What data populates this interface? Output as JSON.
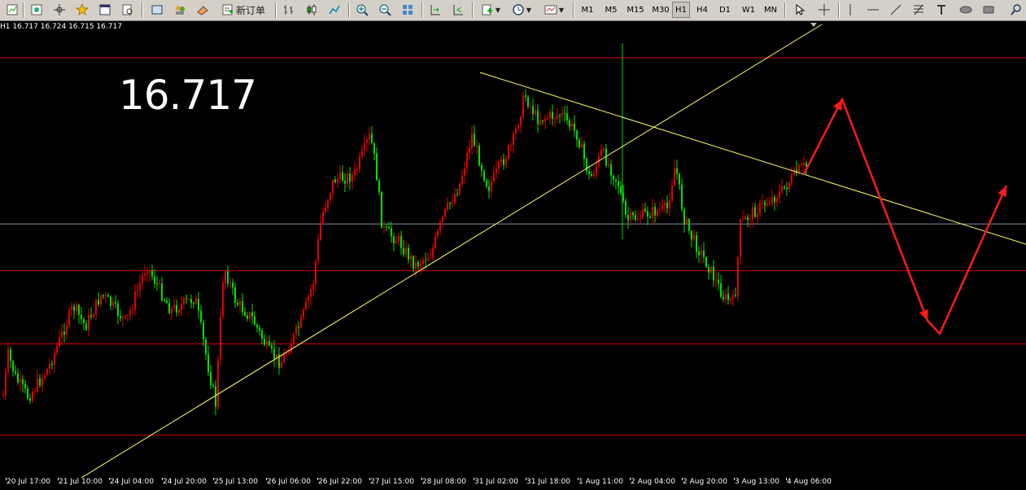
{
  "toolbar": {
    "new_order_label": "新订单",
    "timeframes": [
      "M1",
      "M5",
      "M15",
      "M30",
      "H1",
      "H4",
      "D1",
      "W1",
      "MN"
    ],
    "active_timeframe": "H1"
  },
  "info_bar": {
    "timeframe": "H1",
    "ohlc": "16.717 16.724 16.715 16.717"
  },
  "price_label": "16.717",
  "x_axis": {
    "labels": [
      "20 Jul 17:00",
      "21 Jul 10:00",
      "24 Jul 04:00",
      "24 Jul 20:00",
      "25 Jul 13:00",
      "26 Jul 06:00",
      "26 Jul 22:00",
      "27 Jul 15:00",
      "28 Jul 08:00",
      "31 Jul 02:00",
      "31 Jul 18:00",
      "1 Aug 11:00",
      "2 Aug 04:00",
      "2 Aug 20:00",
      "3 Aug 13:00",
      "4 Aug 06:00"
    ]
  },
  "colors": {
    "background": "#000000",
    "bull_candle": "#e00000",
    "bear_candle": "#00e000",
    "horizontal_levels": "#d00000",
    "current_price_line": "#7f8fa6",
    "trend_lines": "#ffff66",
    "forecast_arrows": "#ff1a1a"
  },
  "chart_data": {
    "type": "candlestick",
    "symbol_timeframe": "H1",
    "current_price": 16.717,
    "y_range": [
      16.3,
      17.05
    ],
    "horizontal_levels": [
      16.99,
      16.64,
      16.52,
      16.37
    ],
    "annotations": [
      "ascending trend line",
      "descending trend line",
      "projected red zig-zag forecast path"
    ]
  }
}
